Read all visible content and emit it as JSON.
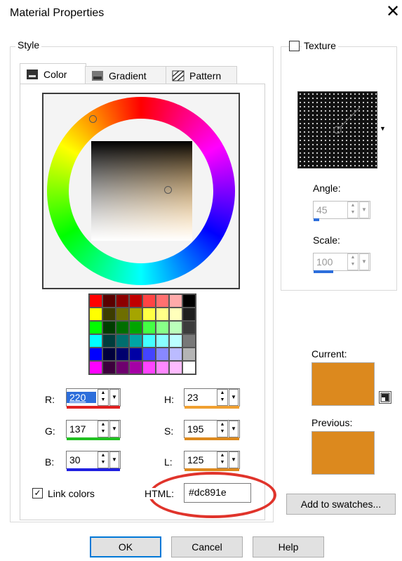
{
  "window": {
    "title": "Material Properties",
    "close_glyph": "✕"
  },
  "style_group": {
    "label": "Style"
  },
  "tabs": [
    {
      "label": "Color",
      "icon": "color-tab-icon"
    },
    {
      "label": "Gradient",
      "icon": "gradient-tab-icon"
    },
    {
      "label": "Pattern",
      "icon": "pattern-tab-icon"
    }
  ],
  "palette": [
    [
      "#ff0000",
      "#5a0000",
      "#8c0000",
      "#c00000",
      "#ff4444",
      "#ff7070",
      "#ffaaaa",
      "#000000"
    ],
    [
      "#ffff00",
      "#3c3c00",
      "#6e6e00",
      "#a5a500",
      "#ffff44",
      "#ffff88",
      "#ffffbb",
      "#1e1e1e"
    ],
    [
      "#00ff00",
      "#003c00",
      "#006e00",
      "#00a500",
      "#44ff44",
      "#88ff88",
      "#bbffbb",
      "#3c3c3c"
    ],
    [
      "#00ffff",
      "#003c3c",
      "#006e6e",
      "#00a5a5",
      "#44ffff",
      "#88ffff",
      "#bbffff",
      "#787878"
    ],
    [
      "#0000ff",
      "#00003c",
      "#00006e",
      "#0000a5",
      "#4444ff",
      "#8888ff",
      "#bbbbff",
      "#b4b4b4"
    ],
    [
      "#ff00ff",
      "#3c003c",
      "#6e006e",
      "#a500a5",
      "#ff44ff",
      "#ff88ff",
      "#ffbbff",
      "#ffffff"
    ]
  ],
  "channels": {
    "R": {
      "label": "R:",
      "value": "220",
      "bar_color": "#e02020"
    },
    "G": {
      "label": "G:",
      "value": "137",
      "bar_color": "#20c020"
    },
    "B": {
      "label": "B:",
      "value": "30",
      "bar_color": "#2020e0"
    },
    "H": {
      "label": "H:",
      "value": "23",
      "bar_color": "#f0a030"
    },
    "S": {
      "label": "S:",
      "value": "195",
      "bar_color": "#dc891e"
    },
    "L": {
      "label": "L:",
      "value": "125",
      "bar_color": "#dc891e"
    }
  },
  "link_colors": {
    "label": "Link colors",
    "checked": true
  },
  "html_field": {
    "label": "HTML:",
    "value": "#dc891e"
  },
  "texture": {
    "label": "Texture",
    "checked": false,
    "angle_label": "Angle:",
    "angle_value": "45",
    "scale_label": "Scale:",
    "scale_value": "100"
  },
  "current": {
    "label": "Current:",
    "color": "#dc891e"
  },
  "previous": {
    "label": "Previous:",
    "color": "#dc891e"
  },
  "add_to_swatches_label": "Add to swatches...",
  "buttons": {
    "ok": "OK",
    "cancel": "Cancel",
    "help": "Help"
  },
  "annotation_color": "#e0342b"
}
